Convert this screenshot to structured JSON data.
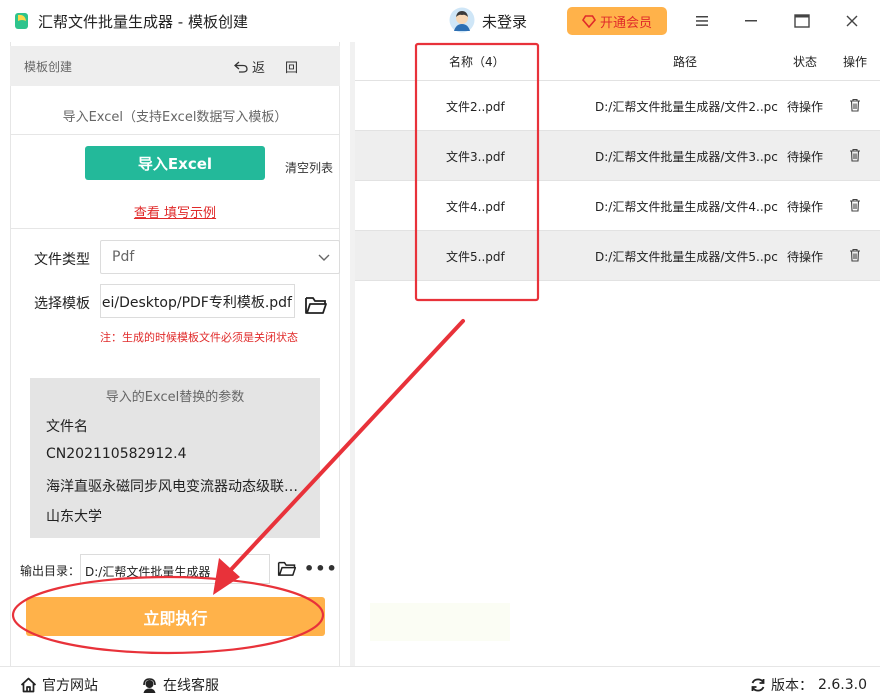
{
  "window": {
    "title": "汇帮文件批量生成器 - 模板创建",
    "login_text": "未登录",
    "vip_label": "开通会员",
    "accent_color": "#23b99a",
    "vip_color": "#ffb24a",
    "alert_color": "#e02a2a"
  },
  "left_panel": {
    "header_title": "模板创建",
    "back_label": "返",
    "back2_label": "回",
    "import_caption": "导入Excel（支持Excel数据写入模板）",
    "import_button": "导入Excel",
    "clear_list": "清空列表",
    "sample_link": "查看 填写示例",
    "file_type_label": "文件类型",
    "file_type_value": "Pdf",
    "template_label": "选择模板",
    "template_value": "ei/Desktop/PDF专利模板.pdf",
    "note": "注：生成的时候模板文件必须是关闭状态",
    "params_title": "导入的Excel替换的参数",
    "params": [
      "文件名",
      "CN202110582912.4",
      "海洋直驱永磁同步风电变流器动态级联…",
      "山东大学"
    ],
    "output_label": "输出目录：",
    "output_value": "D:/汇帮文件批量生成器",
    "run_button": "立即执行"
  },
  "table": {
    "headers": {
      "name": "名称（4）",
      "path": "路径",
      "status": "状态",
      "action": "操作"
    },
    "rows": [
      {
        "name": "文件2..pdf",
        "path": "D:/汇帮文件批量生成器/文件2..pc",
        "status": "待操作"
      },
      {
        "name": "文件3..pdf",
        "path": "D:/汇帮文件批量生成器/文件3..pc",
        "status": "待操作"
      },
      {
        "name": "文件4..pdf",
        "path": "D:/汇帮文件批量生成器/文件4..pc",
        "status": "待操作"
      },
      {
        "name": "文件5..pdf",
        "path": "D:/汇帮文件批量生成器/文件5..pc",
        "status": "待操作"
      }
    ]
  },
  "statusbar": {
    "website": "官方网站",
    "support": "在线客服",
    "version_label": "版本：",
    "version": "2.6.3.0"
  }
}
